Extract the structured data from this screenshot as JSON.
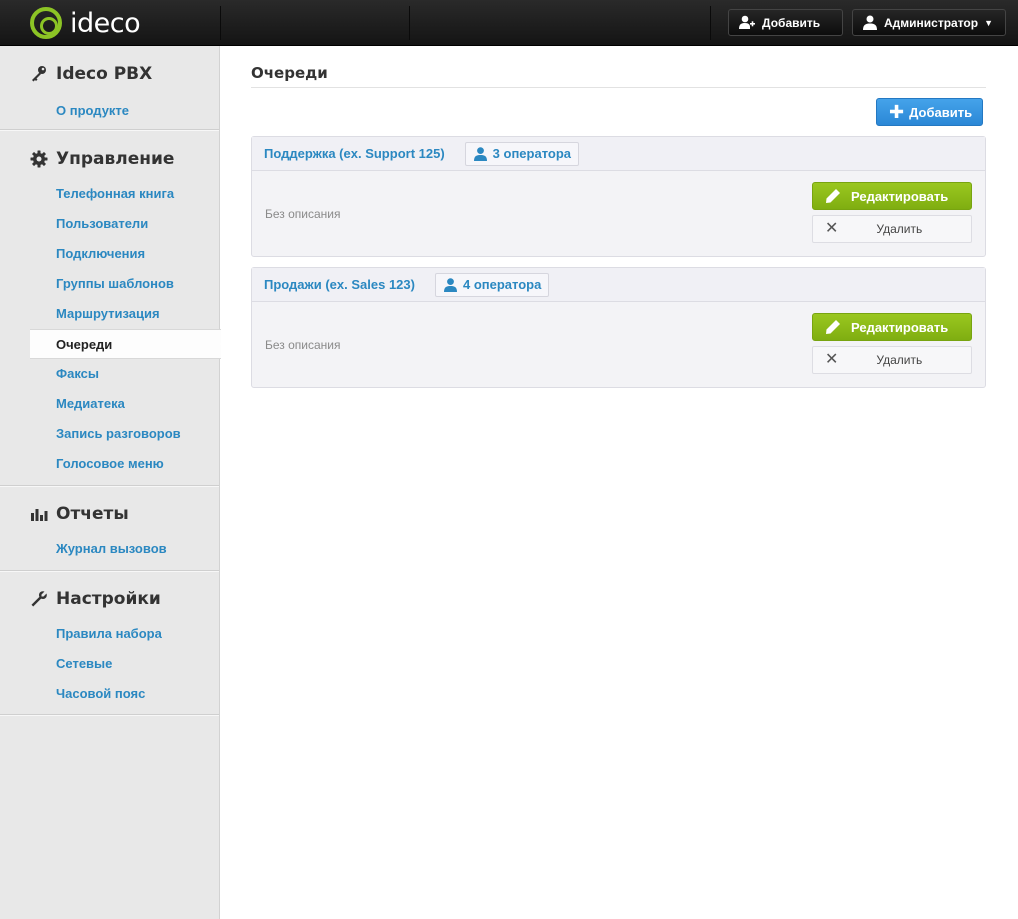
{
  "header": {
    "logo_text": "ideco",
    "add_label": "Добавить",
    "user_label": "Администратор"
  },
  "sidebar": {
    "sections": [
      {
        "title": "Ideco PBX",
        "icon": "key-icon",
        "items": [
          "О продукте"
        ]
      },
      {
        "title": "Управление",
        "icon": "gear-icon",
        "items": [
          "Телефонная книга",
          "Пользователи",
          "Подключения",
          "Группы шаблонов",
          "Маршрутизация",
          "Очереди",
          "Факсы",
          "Медиатека",
          "Запись разговоров",
          "Голосовое меню"
        ]
      },
      {
        "title": "Отчеты",
        "icon": "bar-chart-icon",
        "items": [
          "Журнал вызовов"
        ]
      },
      {
        "title": "Настройки",
        "icon": "wrench-icon",
        "items": [
          "Правила набора",
          "Сетевые",
          "Часовой пояс"
        ]
      }
    ],
    "active_item": "Очереди"
  },
  "main": {
    "title": "Очереди",
    "add_label": "Добавить",
    "queues": [
      {
        "name": "Поддержка (ex. Support 125)",
        "operators": "3 оператора",
        "description": "Без описания",
        "edit_label": "Редактировать",
        "delete_label": "Удалить"
      },
      {
        "name": "Продажи (ex. Sales 123)",
        "operators": "4 оператора",
        "description": "Без описания",
        "edit_label": "Редактировать",
        "delete_label": "Удалить"
      }
    ]
  },
  "colors": {
    "accent_blue": "#2b88c1",
    "button_blue": "#2b87d6",
    "button_green": "#7fae11",
    "logo_green": "#8cc425"
  }
}
